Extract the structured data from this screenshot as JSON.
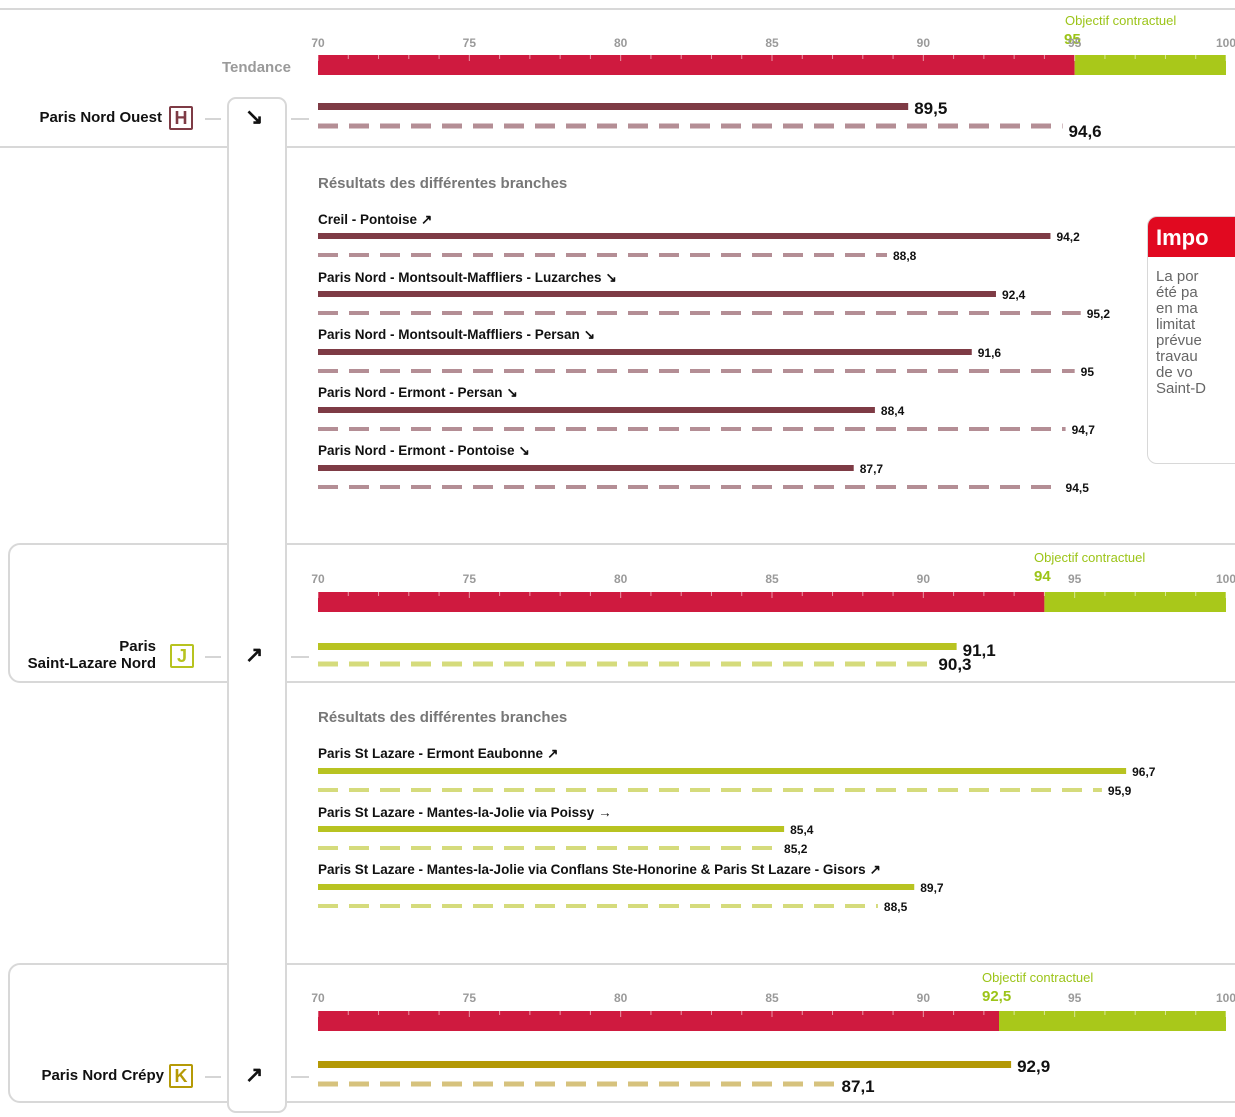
{
  "tendance_label": "Tendance",
  "section_title": "Résultats des différentes branches",
  "axis": {
    "min": 70,
    "max": 100,
    "ticks": [
      "70",
      "75",
      "80",
      "85",
      "90",
      "95",
      "100"
    ]
  },
  "colors": {
    "below_target": "#cf1a3f",
    "above_target": "#a9c81a",
    "grid": "#e4e4e4"
  },
  "info_box": {
    "title": "Impo",
    "text": "La por\nété pa\nen ma\nlimitat\nprévue\ntravau\nde vo\nSaint-D"
  },
  "chart_data": [
    {
      "type": "bar",
      "line": "Paris Nord Ouest",
      "badge": "H",
      "badge_color": "#7e3b45",
      "trend": "↘",
      "objective_label": "Objectif contractuel",
      "objective": 95,
      "objective_text": "95",
      "bar_color": "#7e3b45",
      "dash_color": "#b48e95",
      "series": [
        {
          "value": 89.5,
          "label": "89,5"
        },
        {
          "value": 94.6,
          "label": "94,6"
        }
      ],
      "branches": [
        {
          "name": "Creil - Pontoise",
          "trend": "↗",
          "values": [
            94.2,
            88.8
          ],
          "labels": [
            "94,2",
            "88,8"
          ]
        },
        {
          "name": "Paris Nord - Montsoult-Maffliers - Luzarches",
          "trend": "↘",
          "values": [
            92.4,
            95.2
          ],
          "labels": [
            "92,4",
            "95,2"
          ]
        },
        {
          "name": "Paris Nord - Montsoult-Maffliers - Persan",
          "trend": "↘",
          "values": [
            91.6,
            95
          ],
          "labels": [
            "91,6",
            "95"
          ]
        },
        {
          "name": "Paris Nord - Ermont - Persan",
          "trend": "↘",
          "values": [
            88.4,
            94.7
          ],
          "labels": [
            "88,4",
            "94,7"
          ]
        },
        {
          "name": "Paris Nord - Ermont - Pontoise",
          "trend": "↘",
          "values": [
            87.7,
            94.5
          ],
          "labels": [
            "87,7",
            "94,5"
          ]
        }
      ]
    },
    {
      "type": "bar",
      "line": "Paris\nSaint-Lazare Nord",
      "badge": "J",
      "badge_color": "#b7c320",
      "trend": "↗",
      "objective_label": "Objectif contractuel",
      "objective": 94,
      "objective_text": "94",
      "bar_color": "#b8c321",
      "dash_color": "#d5db7c",
      "series": [
        {
          "value": 91.1,
          "label": "91,1"
        },
        {
          "value": 90.3,
          "label": "90,3"
        }
      ],
      "branches": [
        {
          "name": "Paris St Lazare - Ermont Eaubonne",
          "trend": "↗",
          "values": [
            96.7,
            95.9
          ],
          "labels": [
            "96,7",
            "95,9"
          ]
        },
        {
          "name": "Paris St Lazare - Mantes-la-Jolie via Poissy",
          "trend": "→",
          "values": [
            85.4,
            85.2
          ],
          "labels": [
            "85,4",
            "85,2"
          ]
        },
        {
          "name": "Paris St Lazare - Mantes-la-Jolie via Conflans Ste-Honorine & Paris St Lazare - Gisors",
          "trend": "↗",
          "values": [
            89.7,
            88.5
          ],
          "labels": [
            "89,7",
            "88,5"
          ]
        }
      ]
    },
    {
      "type": "bar",
      "line": "Paris Nord Crépy",
      "badge": "K",
      "badge_color": "#b59a06",
      "trend": "↗",
      "objective_label": "Objectif contractuel",
      "objective": 92.5,
      "objective_text": "92,5",
      "bar_color": "#b49906",
      "dash_color": "#d6c27d",
      "series": [
        {
          "value": 92.9,
          "label": "92,9"
        },
        {
          "value": 87.1,
          "label": "87,1"
        }
      ],
      "branches": []
    }
  ]
}
